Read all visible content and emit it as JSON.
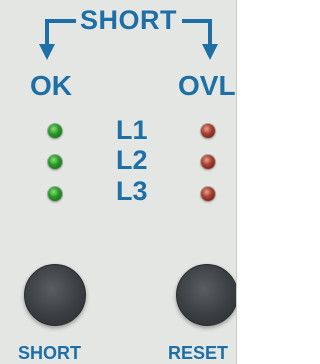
{
  "colors": {
    "panel_bg": "#e4e6e4",
    "label_blue": "#1d6fa6",
    "led_green": "#2a9c2a",
    "led_red": "#a84232",
    "button_dark": "#3b3e42"
  },
  "header": {
    "title": "SHORT"
  },
  "status": {
    "ok_label": "OK",
    "ovl_label": "OVL"
  },
  "lines": [
    {
      "label": "L1",
      "ok_led": "green",
      "ovl_led": "red"
    },
    {
      "label": "L2",
      "ok_led": "green",
      "ovl_led": "red"
    },
    {
      "label": "L3",
      "ok_led": "green",
      "ovl_led": "red"
    }
  ],
  "buttons": {
    "short_label": "SHORT",
    "reset_label": "RESET"
  },
  "icons": {
    "left_arrow": "arrow-down-left-icon",
    "right_arrow": "arrow-down-right-icon"
  }
}
